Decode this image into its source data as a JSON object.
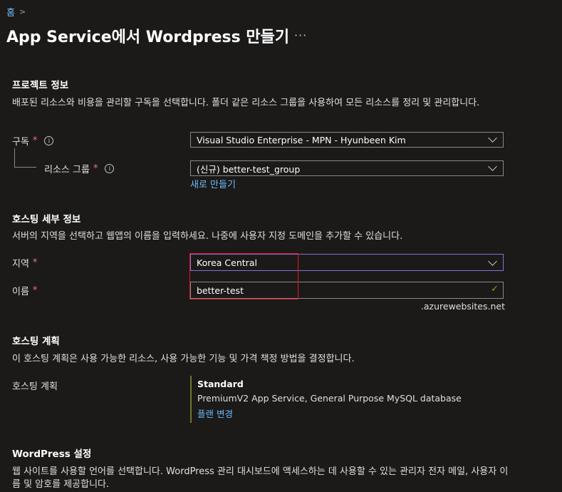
{
  "breadcrumb": {
    "home": "홈",
    "separator": ">"
  },
  "page": {
    "title": "App Service에서 Wordpress 만들기",
    "more": "···"
  },
  "project": {
    "heading": "프로젝트 정보",
    "description": "배포된 리소스와 비용을 관리할 구독을 선택합니다. 폴더 같은 리소스 그룹을 사용하여 모든 리소스를 정리 및 관리합니다.",
    "subscription_label": "구독",
    "subscription_value": "Visual Studio Enterprise - MPN - Hyunbeen Kim",
    "resource_group_label": "리소스 그룹",
    "resource_group_value": "(신규) better-test_group",
    "create_new": "새로 만들기"
  },
  "hosting": {
    "heading": "호스팅 세부 정보",
    "description": "서버의 지역을 선택하고 웹앱의 이름을 입력하세요. 나중에 사용자 지정 도메인을 추가할 수 있습니다.",
    "region_label": "지역",
    "region_value": "Korea Central",
    "name_label": "이름",
    "name_value": "better-test",
    "domain_suffix": ".azurewebsites.net"
  },
  "plan": {
    "heading": "호스팅 계획",
    "description": "이 호스팅 계획은 사용 가능한 리소스, 사용 가능한 기능 및 가격 책정 방법을 결정합니다.",
    "label": "호스팅 계획",
    "tier": "Standard",
    "detail": "PremiumV2 App Service, General Purpose MySQL database",
    "change": "플랜 변경"
  },
  "wordpress": {
    "heading": "WordPress 설정",
    "description": "웹 사이트를 사용할 언어를 선택합니다. WordPress 관리 대시보드에 액세스하는 데 사용할 수 있는 관리자 전자 메일, 사용자 이름 및 암호를 제공합니다."
  },
  "required_mark": "*",
  "colors": {
    "background": "#1b1a19",
    "link": "#6cb8f6",
    "required": "#f1707b",
    "focus": "#8d6fd4",
    "valid": "#6bb700",
    "highlight": "#e81123"
  }
}
